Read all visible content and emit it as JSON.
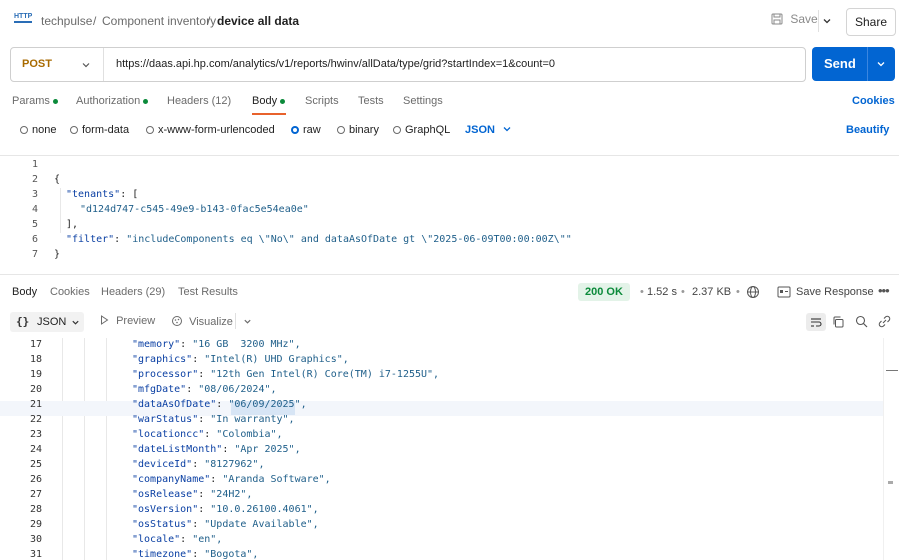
{
  "header": {
    "workspace": "techpulse",
    "separator": "/",
    "collection": "Component inventory",
    "request": "device all data",
    "save_label": "Save",
    "share_label": "Share",
    "method_badge": "HTTP"
  },
  "request": {
    "method": "POST",
    "url": "https://daas.api.hp.com/analytics/v1/reports/hwinv/allData/type/grid?startIndex=1&count=0",
    "send_label": "Send"
  },
  "tabs": {
    "params": "Params",
    "authorization": "Authorization",
    "headers": "Headers (12)",
    "body": "Body",
    "scripts": "Scripts",
    "tests": "Tests",
    "settings": "Settings",
    "cookies": "Cookies"
  },
  "body_types": {
    "none": "none",
    "form_data": "form-data",
    "urlencoded": "x-www-form-urlencoded",
    "raw": "raw",
    "binary": "binary",
    "graphql": "GraphQL",
    "format": "JSON",
    "beautify": "Beautify"
  },
  "request_body": {
    "line_numbers": [
      "1",
      "2",
      "3",
      "4",
      "5",
      "6",
      "7"
    ],
    "line2": "{",
    "line3_key": "\"tenants\"",
    "line3_rest": ": [",
    "line4": "\"d124d747-c545-49e9-b143-0fac5e54ea0e\"",
    "line5": "],",
    "line6_key": "\"filter\"",
    "line6_sep": ": ",
    "line6_val": "\"includeComponents eq \\\"No\\\" and dataAsOfDate gt \\\"2025-06-09T00:00:00Z\\\"\"",
    "line7": "}"
  },
  "response": {
    "tabs": {
      "body": "Body",
      "cookies": "Cookies",
      "headers": "Headers (29)",
      "test_results": "Test Results"
    },
    "status": "200 OK",
    "time": "1.52 s",
    "size": "2.37 KB",
    "save_response": "Save Response",
    "format": "JSON",
    "preview": "Preview",
    "visualize": "Visualize",
    "lines": [
      {
        "n": "17",
        "key": "\"memory\"",
        "val": "\"16 GB  3200 MHz\","
      },
      {
        "n": "18",
        "key": "\"graphics\"",
        "val": "\"Intel(R) UHD Graphics\","
      },
      {
        "n": "19",
        "key": "\"processor\"",
        "val": "\"12th Gen Intel(R) Core(TM) i7-1255U\","
      },
      {
        "n": "20",
        "key": "\"mfgDate\"",
        "val": "\"08/06/2024\","
      },
      {
        "n": "21",
        "key": "\"dataAsOfDate\"",
        "val": "\"06/09/2025\","
      },
      {
        "n": "22",
        "key": "\"warStatus\"",
        "val": "\"In warranty\","
      },
      {
        "n": "23",
        "key": "\"locationcc\"",
        "val": "\"Colombia\","
      },
      {
        "n": "24",
        "key": "\"dateListMonth\"",
        "val": "\"Apr 2025\","
      },
      {
        "n": "25",
        "key": "\"deviceId\"",
        "val": "\"8127962\","
      },
      {
        "n": "26",
        "key": "\"companyName\"",
        "val": "\"Aranda Software\","
      },
      {
        "n": "27",
        "key": "\"osRelease\"",
        "val": "\"24H2\","
      },
      {
        "n": "28",
        "key": "\"osVersion\"",
        "val": "\"10.0.26100.4061\","
      },
      {
        "n": "29",
        "key": "\"osStatus\"",
        "val": "\"Update Available\","
      },
      {
        "n": "30",
        "key": "\"locale\"",
        "val": "\"en\","
      },
      {
        "n": "31",
        "key": "\"timezone\"",
        "val": "\"Bogota\","
      }
    ]
  },
  "colors": {
    "accent": "#0265d2",
    "status_ok": "#0b8a3a",
    "method": "#a86a00",
    "active_tab": "#e8622c"
  }
}
